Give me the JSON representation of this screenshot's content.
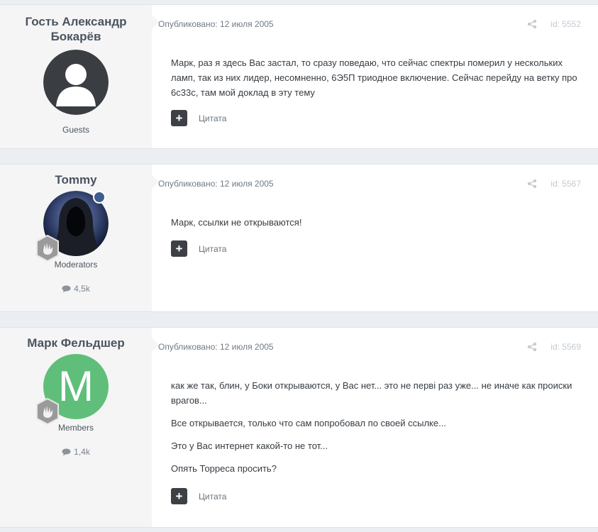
{
  "posts": [
    {
      "author": "Гость Александр Бокарёв",
      "group": "Guests",
      "count": "",
      "meta": "Опубликовано: 12 июля 2005",
      "post_id": "id: 5552",
      "paragraphs": [
        "Марк, раз я здесь Вас застал, то сразу поведаю, что сейчас спектры померил у нескольких ламп, так из них лидер, несомненно, 6Э5П триодное включение. Сейчас перейду на ветку про 6с33с, там мой доклад в эту тему"
      ],
      "quote_label": "Цитата",
      "avatar_type": "silhouette"
    },
    {
      "author": "Tommy",
      "group": "Moderators",
      "count": "4,5k",
      "meta": "Опубликовано: 12 июля 2005",
      "post_id": "id: 5567",
      "paragraphs": [
        "Марк, ссылки не открываются!"
      ],
      "quote_label": "Цитата",
      "avatar_type": "hood"
    },
    {
      "author": "Марк Фельдшер",
      "group": "Members",
      "count": "1,4k",
      "meta": "Опубликовано: 12 июля 2005",
      "post_id": "id: 5569",
      "paragraphs": [
        "как же так, блин, у Боки открываются, у Вас нет... это не перві раз уже... не иначе как происки врагов...",
        "Все открывается, только что сам попробовал по своей ссылке...",
        "Это у Вас интернет какой-то не тот...",
        "Опять Торреса просить?"
      ],
      "quote_label": "Цитата",
      "avatar_letter": "M",
      "avatar_color": "#5fbf7a"
    }
  ],
  "colors": {
    "page_bg": "#ebeef2",
    "author_bg": "#f5f5f5",
    "quote_button": "#3d4146",
    "moderator_badge": "#3e5d8c"
  }
}
